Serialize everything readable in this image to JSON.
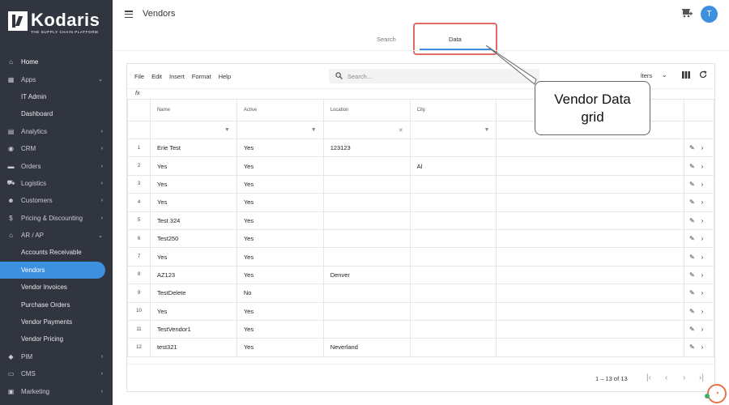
{
  "brand": {
    "name": "Kodaris",
    "tagline": "THE SUPPLY CHAIN PLATFORM"
  },
  "sidebar": {
    "items": [
      {
        "label": "Home",
        "icon": "home-icon",
        "glyph": "⌂",
        "chevron": ""
      },
      {
        "label": "Apps",
        "icon": "apps-icon",
        "glyph": "▦",
        "chevron": "⌄"
      },
      {
        "label": "IT Admin",
        "icon": "",
        "glyph": "",
        "chevron": ""
      },
      {
        "label": "Dashboard",
        "icon": "",
        "glyph": "",
        "chevron": ""
      },
      {
        "label": "Analytics",
        "icon": "analytics-icon",
        "glyph": "▤",
        "chevron": "›"
      },
      {
        "label": "CRM",
        "icon": "crm-icon",
        "glyph": "◉",
        "chevron": "›"
      },
      {
        "label": "Orders",
        "icon": "orders-icon",
        "glyph": "▬",
        "chevron": "›"
      },
      {
        "label": "Logistics",
        "icon": "logistics-icon",
        "glyph": "⛟",
        "chevron": "›"
      },
      {
        "label": "Customers",
        "icon": "customers-icon",
        "glyph": "☻",
        "chevron": "›"
      },
      {
        "label": "Pricing & Discounting",
        "icon": "pricing-icon",
        "glyph": "$",
        "chevron": "›"
      },
      {
        "label": "AR / AP",
        "icon": "bank-icon",
        "glyph": "⌂",
        "chevron": "⌄"
      },
      {
        "label": "Accounts Receivable",
        "icon": "",
        "glyph": "",
        "chevron": ""
      },
      {
        "label": "Vendors",
        "icon": "",
        "glyph": "",
        "chevron": ""
      },
      {
        "label": "Vendor Invoices",
        "icon": "",
        "glyph": "",
        "chevron": ""
      },
      {
        "label": "Purchase Orders",
        "icon": "",
        "glyph": "",
        "chevron": ""
      },
      {
        "label": "Vendor Payments",
        "icon": "",
        "glyph": "",
        "chevron": ""
      },
      {
        "label": "Vendor Pricing",
        "icon": "",
        "glyph": "",
        "chevron": ""
      },
      {
        "label": "PIM",
        "icon": "pim-icon",
        "glyph": "◆",
        "chevron": "›"
      },
      {
        "label": "CMS",
        "icon": "cms-icon",
        "glyph": "▭",
        "chevron": "›"
      },
      {
        "label": "Marketing",
        "icon": "marketing-icon",
        "glyph": "▣",
        "chevron": "›"
      }
    ]
  },
  "header": {
    "title": "Vendors",
    "avatar_initial": "T"
  },
  "tabs": {
    "search": "Search",
    "data": "Data"
  },
  "toolbar": {
    "menus": [
      "File",
      "Edit",
      "Insert",
      "Format",
      "Help"
    ],
    "search_placeholder": "Search...",
    "filters_label": "lters"
  },
  "fx_label": "fx",
  "grid": {
    "columns": [
      "Name",
      "Active",
      "Location",
      "City"
    ],
    "rows": [
      {
        "num": "1",
        "name": "Erie Test",
        "active": "Yes",
        "location": "123123",
        "city": ""
      },
      {
        "num": "2",
        "name": "Yes",
        "active": "Yes",
        "location": "",
        "city": "Al"
      },
      {
        "num": "3",
        "name": "Yes",
        "active": "Yes",
        "location": "",
        "city": ""
      },
      {
        "num": "4",
        "name": "Yes",
        "active": "Yes",
        "location": "",
        "city": ""
      },
      {
        "num": "5",
        "name": "Test 324",
        "active": "Yes",
        "location": "",
        "city": ""
      },
      {
        "num": "6",
        "name": "Test250",
        "active": "Yes",
        "location": "",
        "city": ""
      },
      {
        "num": "7",
        "name": "Yes",
        "active": "Yes",
        "location": "",
        "city": ""
      },
      {
        "num": "8",
        "name": "AZ123",
        "active": "Yes",
        "location": "Denver",
        "city": ""
      },
      {
        "num": "9",
        "name": "TestDelete",
        "active": "No",
        "location": "",
        "city": ""
      },
      {
        "num": "10",
        "name": "Yes",
        "active": "Yes",
        "location": "",
        "city": ""
      },
      {
        "num": "11",
        "name": "TestVendor1",
        "active": "Yes",
        "location": "",
        "city": ""
      },
      {
        "num": "12",
        "name": "test321",
        "active": "Yes",
        "location": "Neverland",
        "city": ""
      }
    ]
  },
  "pagination": {
    "range": "1 – 13 of 13"
  },
  "callout": {
    "line1": "Vendor Data",
    "line2": "grid"
  },
  "colors": {
    "sidebar_bg": "#30353f",
    "accent": "#3d8fe0",
    "highlight": "#e06a6a"
  }
}
